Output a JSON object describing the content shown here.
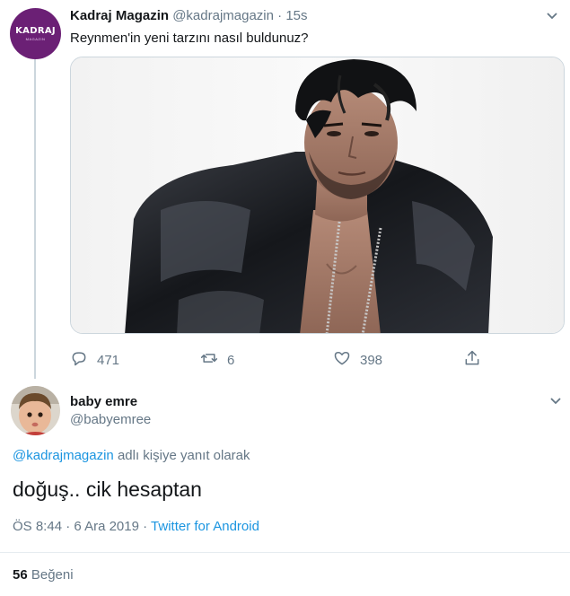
{
  "tweet": {
    "author_name": "Kadraj Magazin",
    "author_handle": "@kadrajmagazin",
    "separator": "·",
    "time": "15s",
    "text": "Reynmen'in yeni tarzını nasıl buldunuz?",
    "avatar_logo": "KADRAJ",
    "avatar_logo_sub": "MAGAZIN",
    "actions": {
      "reply_count": "471",
      "retweet_count": "6",
      "like_count": "398"
    }
  },
  "reply": {
    "author_name": "baby emre",
    "author_handle": "@babyemree",
    "reply_mention": "@kadrajmagazin",
    "reply_suffix": "adlı kişiye yanıt olarak",
    "text": "doğuş.. cik hesaptan",
    "time": "ÖS 8:44",
    "separator": "·",
    "date": "6 Ara 2019",
    "source": "Twitter for Android",
    "likes_count": "56",
    "likes_label": "Beğeni"
  },
  "icons": {
    "reply": "reply-icon",
    "retweet": "retweet-icon",
    "like": "heart-icon",
    "share": "share-icon",
    "caret": "chevron-down-icon"
  },
  "colors": {
    "link": "#1b95e0",
    "muted": "#657786",
    "avatar_brand": "#6b2075"
  }
}
